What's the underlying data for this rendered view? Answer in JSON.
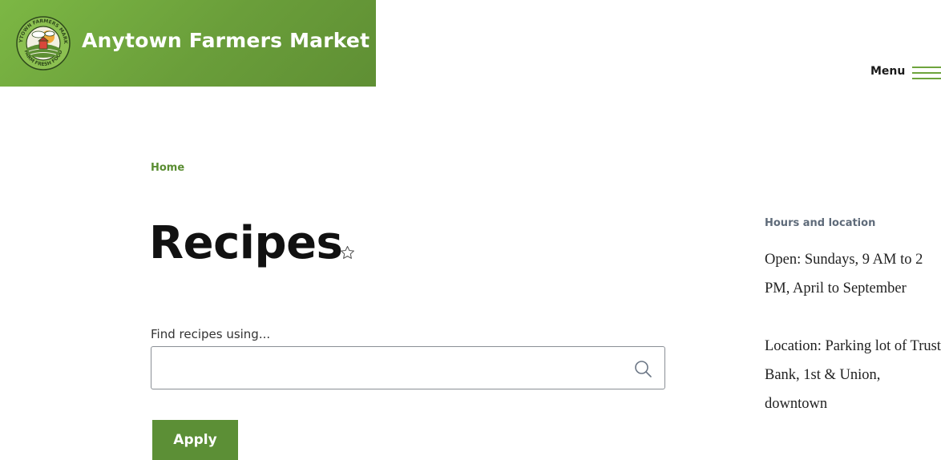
{
  "header": {
    "site_name": "Anytown Farmers Market",
    "logo_ring_top": "ANYTOWN FARMERS MARKET",
    "logo_ring_bottom": "FARM FRESH FOOD",
    "brand_color": "#6a9e3a"
  },
  "nav": {
    "menu_label": "Menu"
  },
  "breadcrumb": {
    "home": "Home"
  },
  "main": {
    "title": "Recipes",
    "search": {
      "label": "Find recipes using...",
      "value": "",
      "placeholder": ""
    },
    "apply_label": "Apply",
    "accent_color": "#5c8f36"
  },
  "sidebar": {
    "heading": "Hours and location",
    "hours": "Open: Sundays, 9 AM to 2 PM, April to September",
    "location": "Location: Parking lot of Trust Bank, 1st & Union, downtown"
  },
  "icons": {
    "logo": "farmers-market-logo-icon",
    "bookmark": "star-outline-icon",
    "search": "search-icon",
    "menu": "hamburger-icon"
  }
}
